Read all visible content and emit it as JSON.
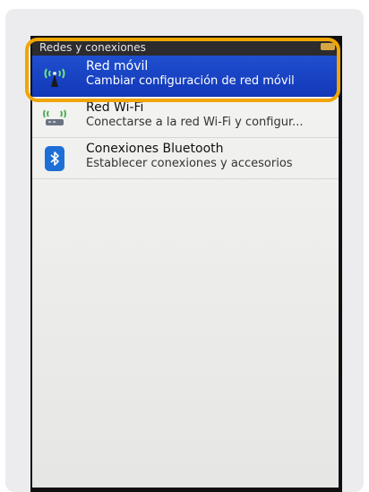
{
  "section": {
    "header": "Redes y conexiones"
  },
  "rows": [
    {
      "title": "Red móvil",
      "subtitle": "Cambiar configuración de red móvil",
      "icon": "antenna-icon"
    },
    {
      "title": "Red Wi-Fi",
      "subtitle": "Conectarse a la red Wi-Fi y configur...",
      "icon": "wifi-router-icon"
    },
    {
      "title": "Conexiones Bluetooth",
      "subtitle": "Establecer conexiones y accesorios",
      "icon": "bluetooth-icon"
    }
  ],
  "colors": {
    "selected_row": "#1f4fcf",
    "highlight_outline": "#f0a500",
    "bluetooth": "#1d6fd6"
  }
}
